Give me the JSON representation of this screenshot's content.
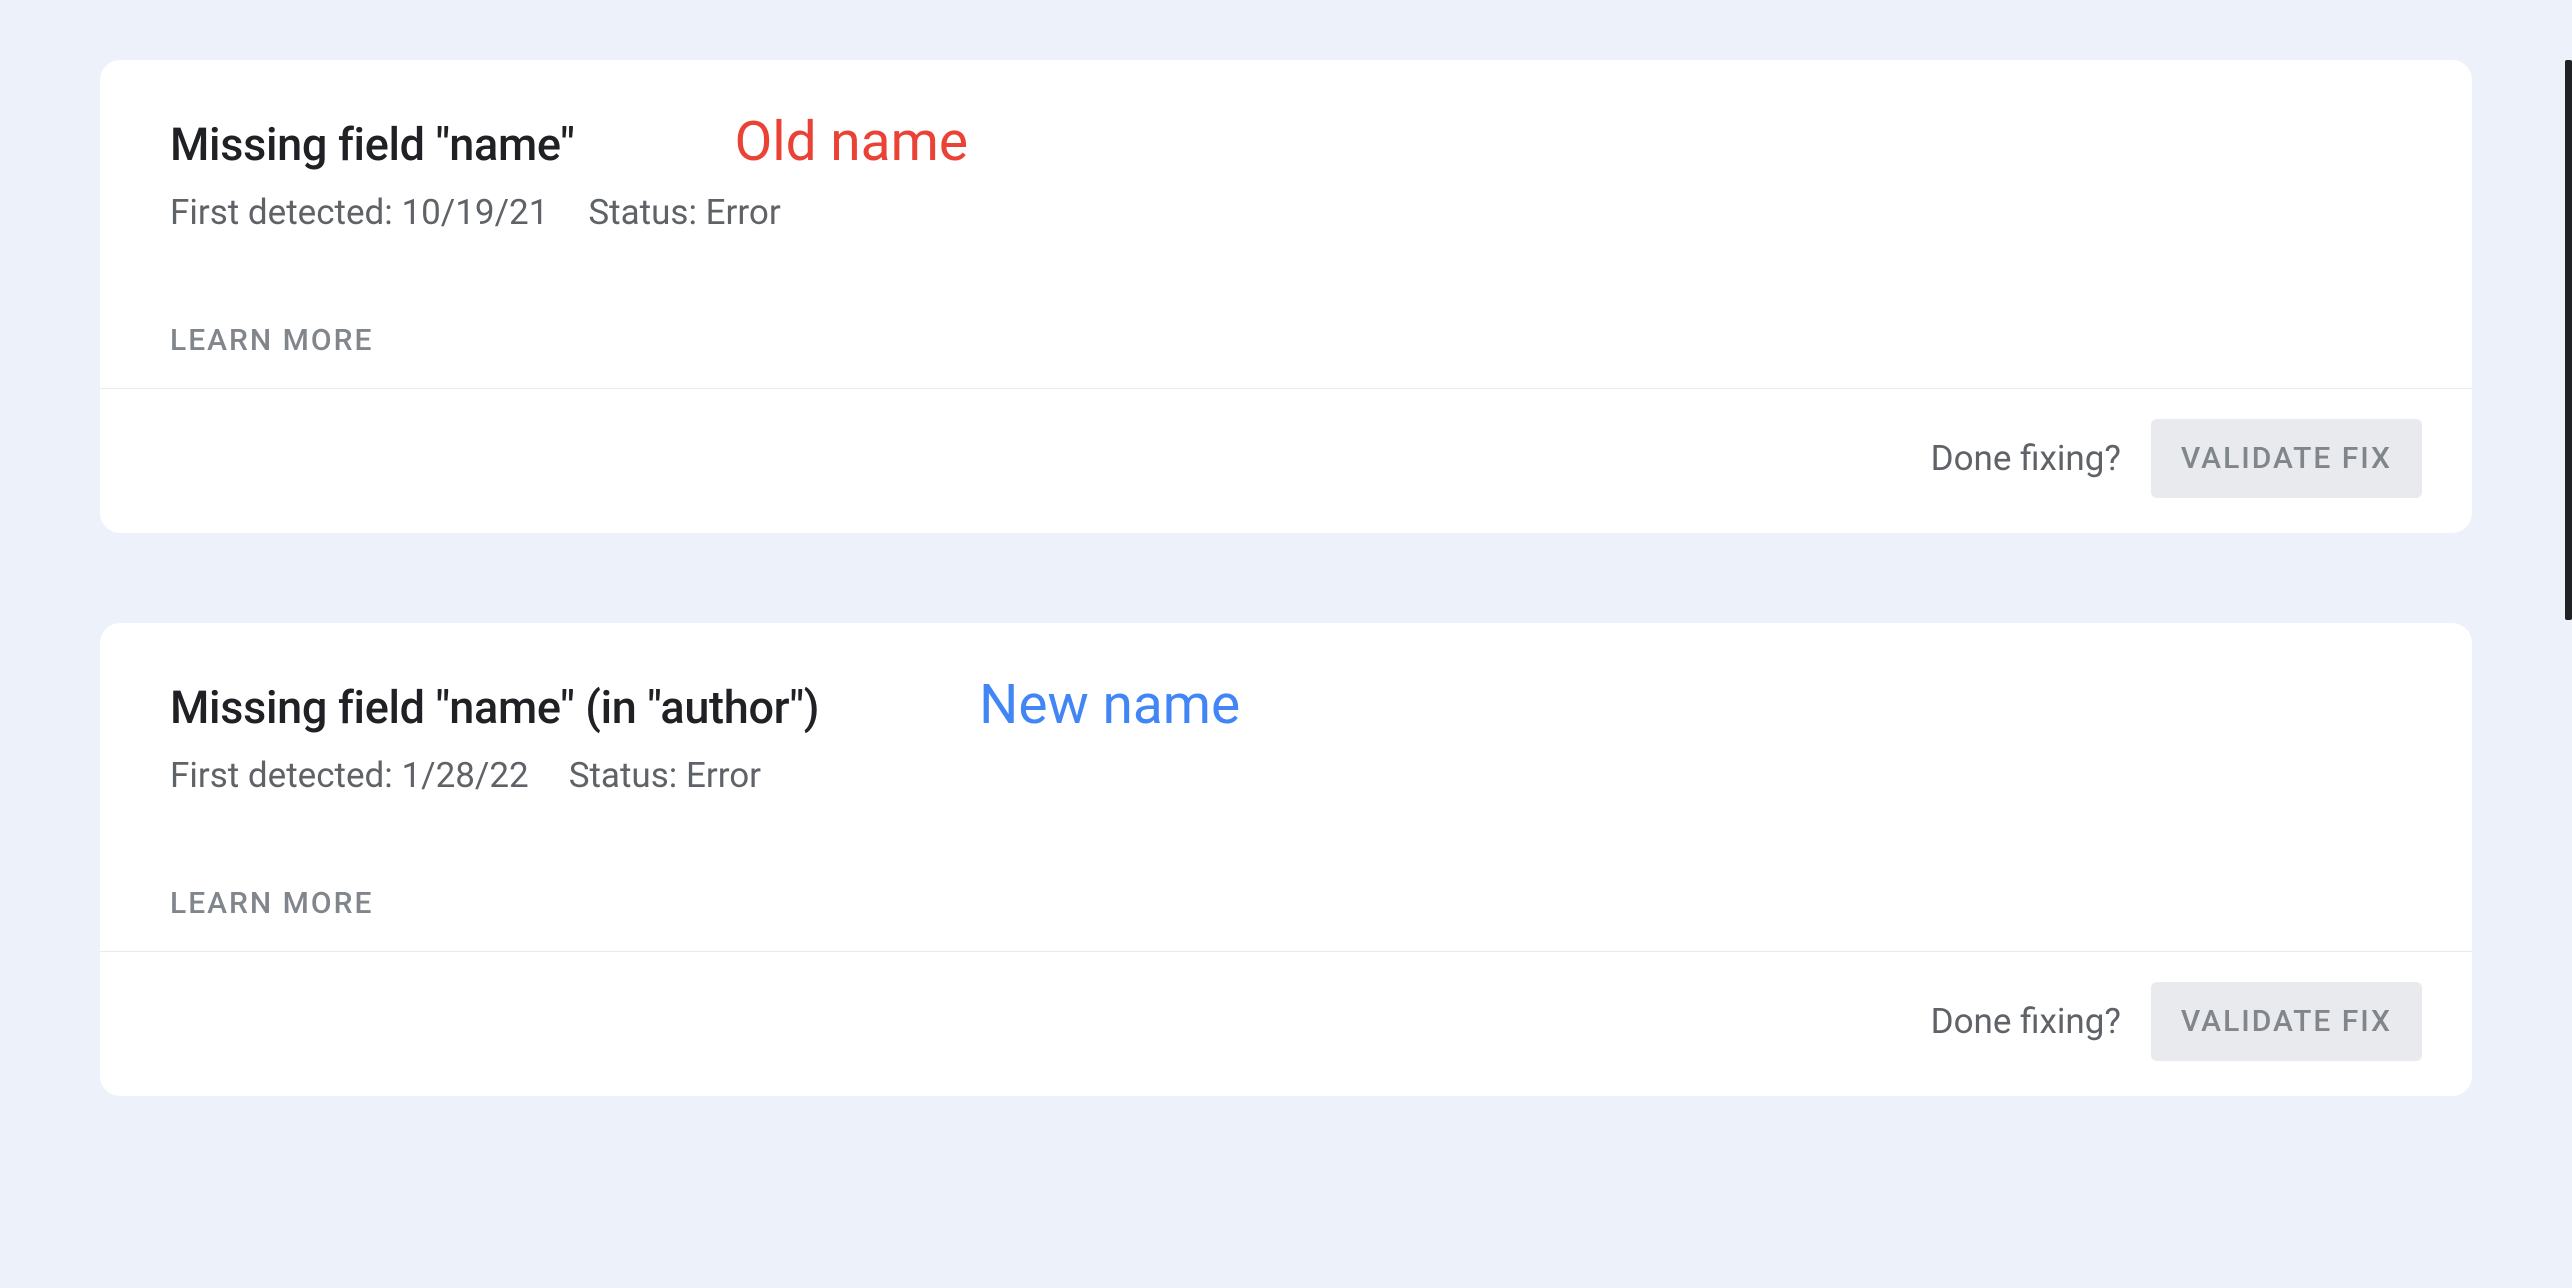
{
  "cards": [
    {
      "title": "Missing field \"name\"",
      "annotation": "Old name",
      "annotation_class": "old",
      "first_detected_label": "First detected:",
      "first_detected_value": "10/19/21",
      "status_label": "Status:",
      "status_value": "Error",
      "learn_more": "LEARN MORE",
      "done_fixing_label": "Done fixing?",
      "validate_label": "VALIDATE FIX"
    },
    {
      "title": "Missing field \"name\" (in \"author\")",
      "annotation": "New name",
      "annotation_class": "new",
      "first_detected_label": "First detected:",
      "first_detected_value": "1/28/22",
      "status_label": "Status:",
      "status_value": "Error",
      "learn_more": "LEARN MORE",
      "done_fixing_label": "Done fixing?",
      "validate_label": "VALIDATE FIX"
    }
  ]
}
